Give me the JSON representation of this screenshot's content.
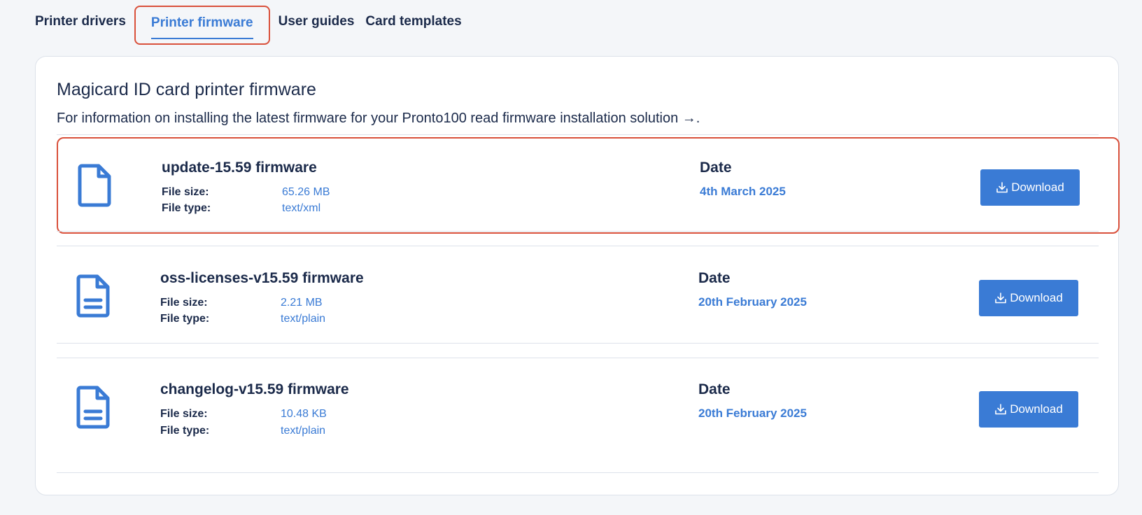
{
  "tabs": [
    {
      "label": "Printer drivers",
      "active": false
    },
    {
      "label": "Printer firmware",
      "active": true
    },
    {
      "label": "User guides",
      "active": false
    },
    {
      "label": "Card templates",
      "active": false
    }
  ],
  "section": {
    "title": "Magicard ID card printer firmware",
    "info": "For information on installing the latest firmware for your Pronto100 read firmware installation solution",
    "info_arrow": "→",
    "info_end": "."
  },
  "labels": {
    "file_size": "File size:",
    "file_type": "File type:",
    "date": "Date",
    "download": "Download"
  },
  "files": [
    {
      "name": "update-15.59 firmware",
      "size": "65.26 MB",
      "type": "text/xml",
      "date": "4th March 2025",
      "icon": "file-icon",
      "highlighted": true
    },
    {
      "name": "oss-licenses-v15.59 firmware",
      "size": "2.21 MB",
      "type": "text/plain",
      "date": "20th February 2025",
      "icon": "file-text-icon",
      "highlighted": false
    },
    {
      "name": "changelog-v15.59 firmware",
      "size": "10.48 KB",
      "type": "text/plain",
      "date": "20th February 2025",
      "icon": "file-text-icon",
      "highlighted": false
    }
  ],
  "colors": {
    "accent": "#3a7bd5",
    "text": "#1b2a4a",
    "highlight_border": "#d9503b",
    "background": "#f4f6f9"
  }
}
